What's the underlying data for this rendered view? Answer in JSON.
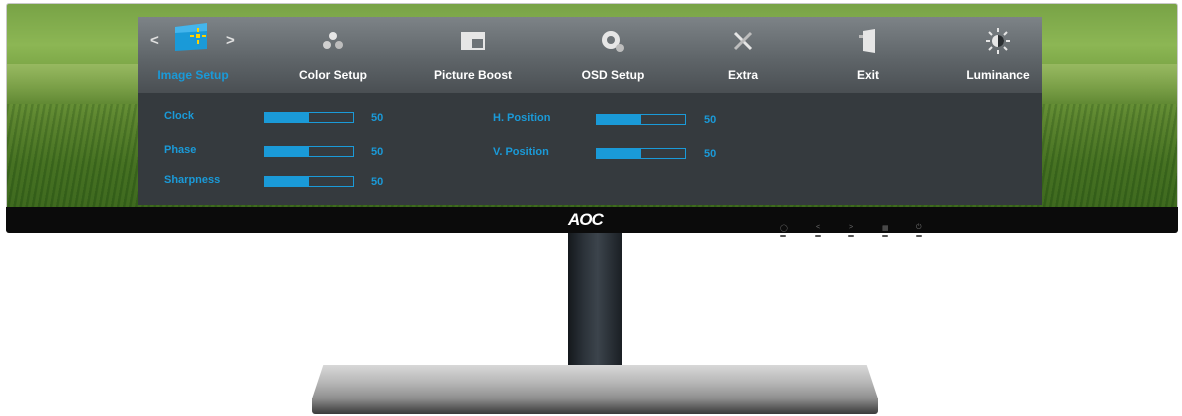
{
  "brand": "AOC",
  "colors": {
    "accent": "#1a9ad8",
    "panel": "#353a3e",
    "tabbar": "#5f6569"
  },
  "menu": {
    "prev_arrow": "<",
    "next_arrow": ">",
    "tabs": [
      {
        "label": "Image Setup",
        "icon": "image-setup-icon",
        "active": true
      },
      {
        "label": "Color Setup",
        "icon": "color-setup-icon",
        "active": false
      },
      {
        "label": "Picture Boost",
        "icon": "picture-boost-icon",
        "active": false
      },
      {
        "label": "OSD Setup",
        "icon": "osd-setup-icon",
        "active": false
      },
      {
        "label": "Extra",
        "icon": "extra-tools-icon",
        "active": false
      },
      {
        "label": "Exit",
        "icon": "exit-door-icon",
        "active": false
      },
      {
        "label": "Luminance",
        "icon": "luminance-icon",
        "active": false
      }
    ]
  },
  "settings": {
    "left": [
      {
        "label": "Clock",
        "value": "50",
        "level": 0.5
      },
      {
        "label": "Phase",
        "value": "50",
        "level": 0.5
      },
      {
        "label": "Sharpness",
        "value": "50",
        "level": 0.5
      }
    ],
    "right": [
      {
        "label": "H. Position",
        "value": "50",
        "level": 0.5
      },
      {
        "label": "V. Position",
        "value": "50",
        "level": 0.5
      }
    ]
  },
  "controls": [
    "auto-icon",
    "left-arrow-icon",
    "right-arrow-icon",
    "menu-icon",
    "power-icon"
  ]
}
